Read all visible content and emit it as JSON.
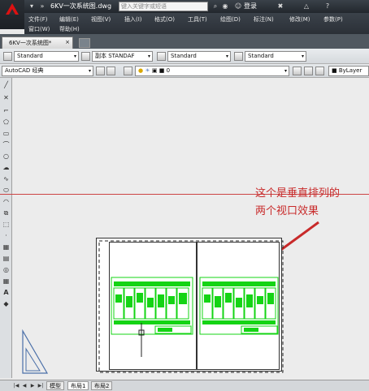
{
  "titlebar": {
    "doc_title": "6KV一次系统图.dwg",
    "search_placeholder": "键入关键字或短语",
    "login": "登录"
  },
  "menus": [
    "文件(F)",
    "编辑(E)",
    "视图(V)",
    "插入(I)",
    "格式(O)",
    "工具(T)",
    "绘图(D)",
    "标注(N)",
    "修改(M)",
    "参数(P)",
    "窗口(W)",
    "帮助(H)"
  ],
  "file_tab": "6KV一次系统图*",
  "toolbar1": {
    "text_style": "Standard",
    "dim_style": "副本 STANDAF",
    "table_style": "Standard",
    "multileader_style": "Standard"
  },
  "toolbar2": {
    "workspace": "AutoCAD 经典",
    "layer": "0",
    "color": "ByLayer"
  },
  "annotation": {
    "line1": "这个是垂直排列的",
    "line2": "两个视口效果"
  },
  "layout_tabs": [
    "模型",
    "布局1",
    "布局2"
  ],
  "colors": {
    "accent_red": "#c82a2a",
    "drawing_green": "#14d414"
  }
}
